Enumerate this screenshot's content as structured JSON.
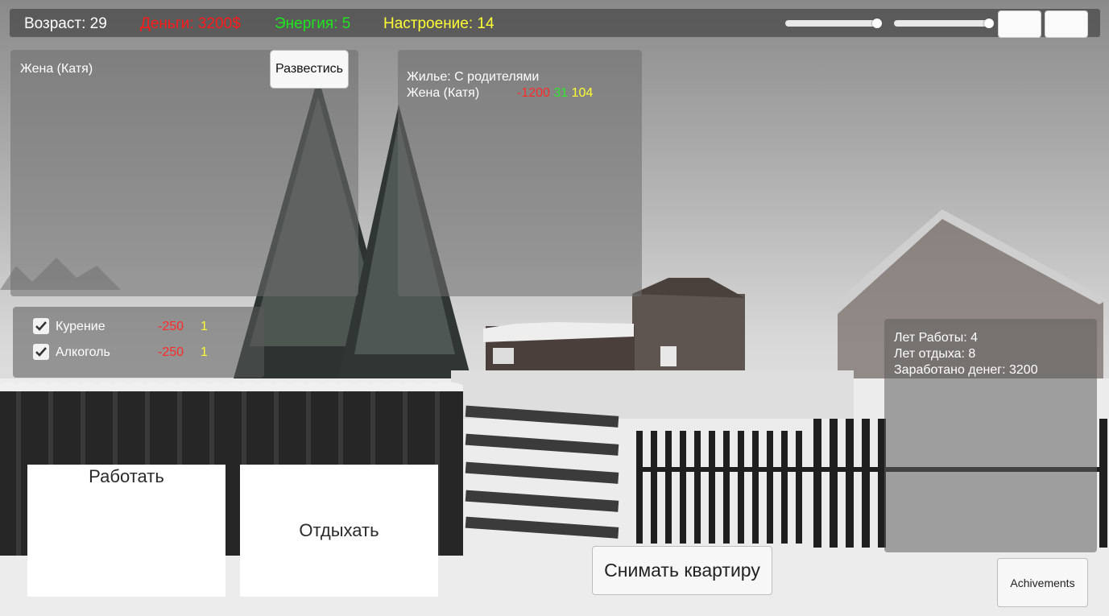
{
  "topbar": {
    "age": "Возраст: 29",
    "money": "Деньги: 3200$",
    "energy": "Энергия: 5",
    "mood": "Настроение: 14",
    "slider1_level": 0.95,
    "slider2_level": 0.98
  },
  "relationship": {
    "title": "Жена (Катя)",
    "divorce_label": "Развестись"
  },
  "expenses": {
    "housing": "Жилье: С родителями",
    "spouse": "Жена (Катя)",
    "spouse_cost": "-1200",
    "spouse_energy": "31",
    "spouse_mood": "104"
  },
  "habits": [
    {
      "label": "Курение",
      "cost": "-250",
      "mood": "1",
      "checked": true
    },
    {
      "label": "Алкоголь",
      "cost": "-250",
      "mood": "1",
      "checked": true
    }
  ],
  "stats": {
    "work_years": "Лет Работы: 4",
    "rest_years": "Лет отдыха: 8",
    "earned": "Заработано денег: 3200"
  },
  "actions": {
    "work": "Работать",
    "rest": "Отдыхать",
    "rent": "Снимать квартиру",
    "achievements": "Achivements"
  },
  "colors": {
    "money": "#ff1a1a",
    "energy": "#1ee61e",
    "mood": "#ffff33"
  }
}
